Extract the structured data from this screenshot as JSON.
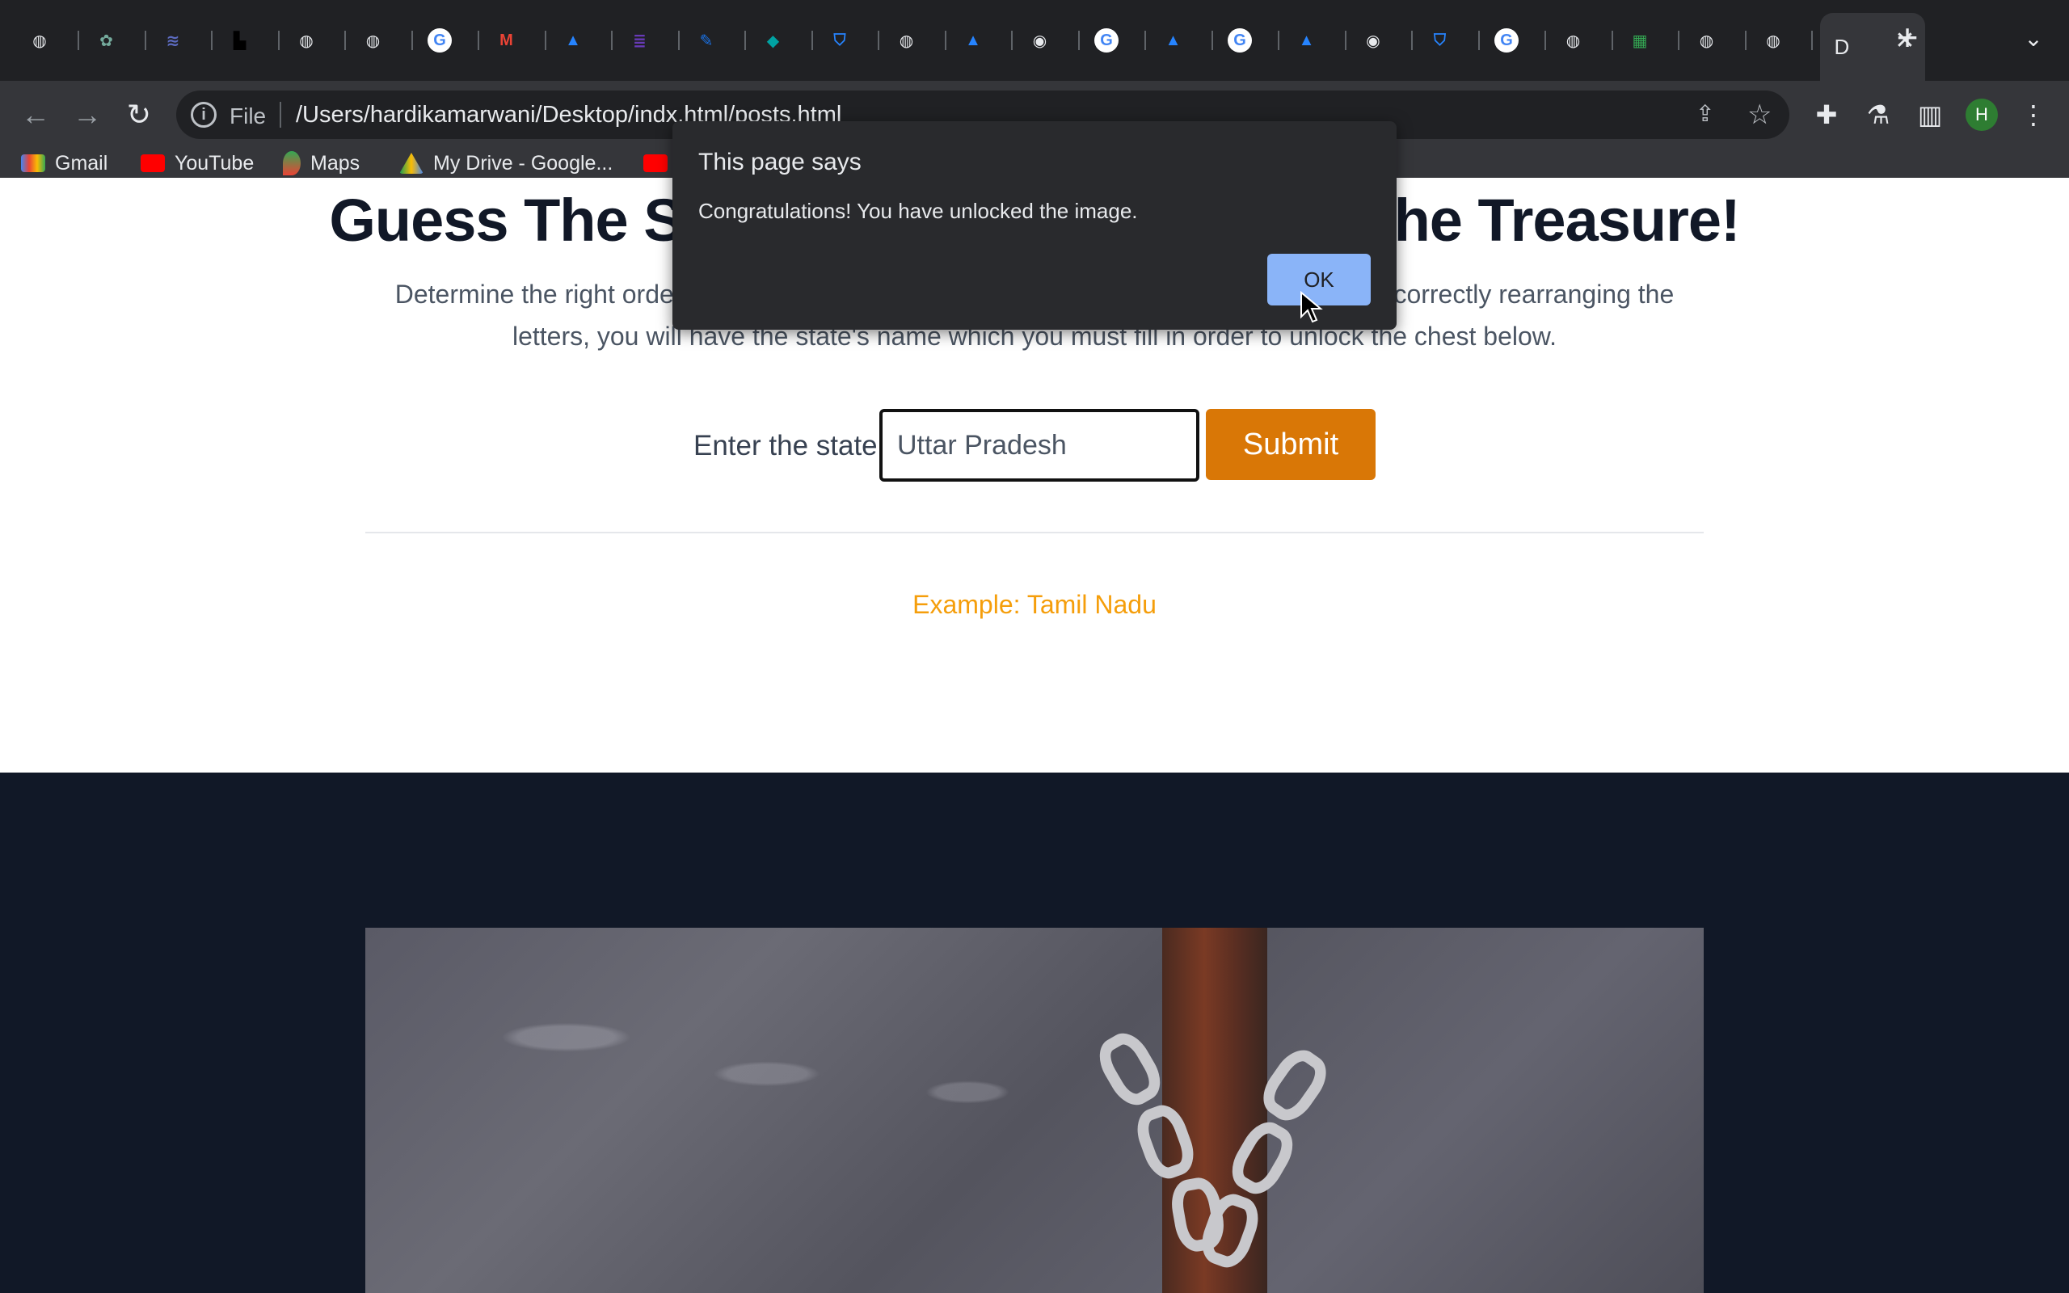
{
  "browser": {
    "address": {
      "scheme": "File",
      "url": "/Users/hardikamarwani/Desktop/indx.html/posts.html"
    },
    "active_tab_initial": "D",
    "profile_initial": "H",
    "bookmarks": [
      "Gmail",
      "YouTube",
      "Maps",
      "My Drive - Google..."
    ],
    "tab_icons": [
      "globe-icon",
      "chatgpt-icon",
      "stack-icon",
      "tiktok-icon",
      "globe-icon",
      "globe-icon",
      "google-icon",
      "gmail-icon",
      "atlassian-icon",
      "list-icon",
      "edit-icon",
      "diamond-icon",
      "bitbucket-icon",
      "globe-icon",
      "atlassian-icon",
      "chrome-icon",
      "google-icon",
      "atlassian-icon",
      "google-icon",
      "atlassian-icon",
      "chrome-icon",
      "bitbucket-icon",
      "google-icon",
      "globe-icon",
      "sheet-icon",
      "globe-icon",
      "globe-icon"
    ]
  },
  "page": {
    "heading": "Guess The S                                              he Treasure!",
    "heading_left": "Guess The S",
    "heading_right": "he Treasure!",
    "desc_line1_left": "Determine the right order",
    "desc_line1_right": "correctly rearranging the",
    "desc_line2": "letters, you will have the state's name which you must fill in order to unlock the chest below.",
    "form": {
      "label": "Enter the state:",
      "value": "Uttar Pradesh",
      "submit": "Submit"
    },
    "example": "Example: Tamil Nadu"
  },
  "dialog": {
    "title": "This page says",
    "message": "Congratulations! You have unlocked the image.",
    "ok": "OK"
  }
}
